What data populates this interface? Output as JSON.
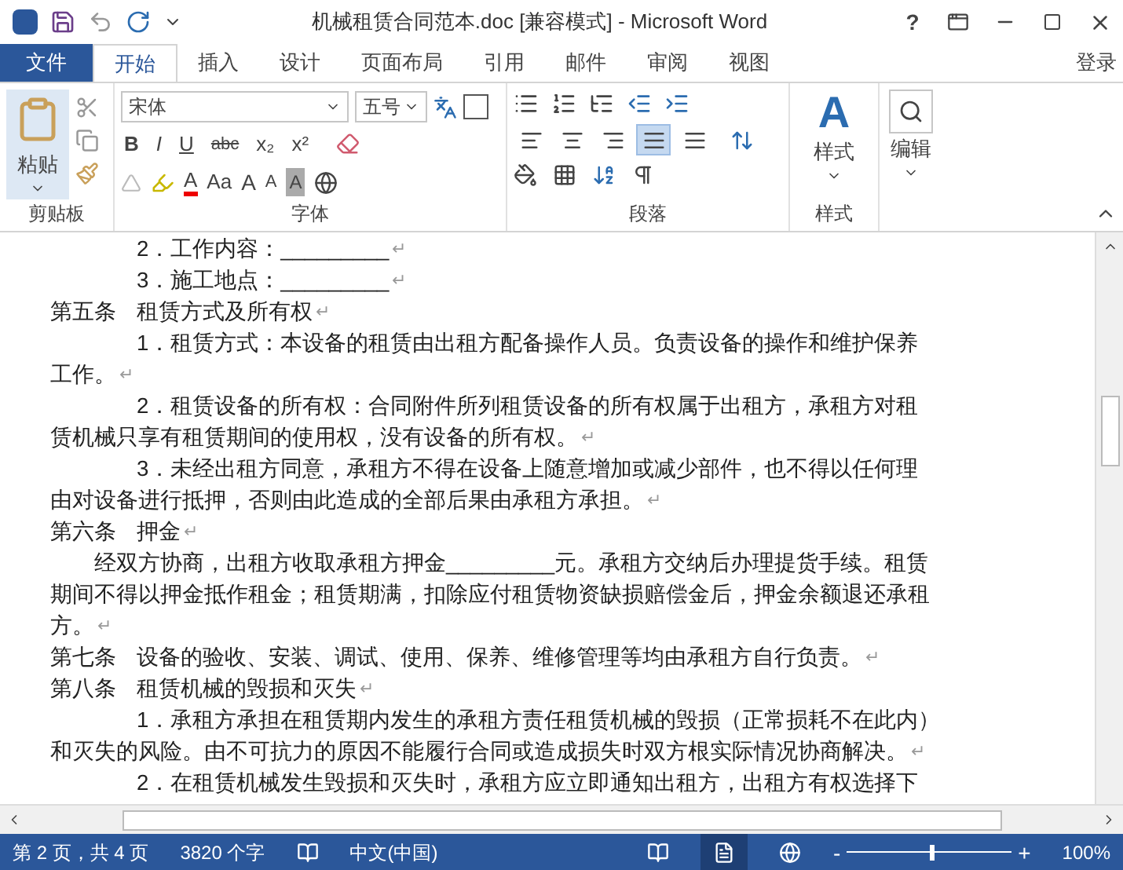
{
  "window": {
    "title": "机械租赁合同范本.doc [兼容模式] - Microsoft Word",
    "help": "?"
  },
  "tabs": [
    {
      "label": "文件",
      "kind": "file",
      "selected": false
    },
    {
      "label": "开始",
      "kind": "tab",
      "selected": true
    },
    {
      "label": "插入",
      "kind": "tab",
      "selected": false
    },
    {
      "label": "设计",
      "kind": "tab",
      "selected": false
    },
    {
      "label": "页面布局",
      "kind": "tab",
      "selected": false
    },
    {
      "label": "引用",
      "kind": "tab",
      "selected": false
    },
    {
      "label": "邮件",
      "kind": "tab",
      "selected": false
    },
    {
      "label": "审阅",
      "kind": "tab",
      "selected": false
    },
    {
      "label": "视图",
      "kind": "tab",
      "selected": false
    }
  ],
  "sign_in": "登录",
  "ribbon": {
    "clipboard": {
      "paste": "粘贴",
      "label": "剪贴板"
    },
    "font": {
      "name": "宋体",
      "size": "五号",
      "format": [
        "B",
        "I",
        "U",
        "abc",
        "x₂",
        "x²"
      ],
      "case": "Aa",
      "grow": "A",
      "shrink": "A",
      "font_color_glyph": "A",
      "shade": "A",
      "label": "字体"
    },
    "paragraph": {
      "align": [
        {
          "kind": "left",
          "selected": false
        },
        {
          "kind": "center",
          "selected": false
        },
        {
          "kind": "right",
          "selected": false
        },
        {
          "kind": "justify",
          "selected": true
        },
        {
          "kind": "distributed",
          "selected": false
        }
      ],
      "label": "段落"
    },
    "styles": {
      "glyph": "A",
      "button": "样式",
      "label": "样式"
    },
    "editing": {
      "button": "编辑"
    }
  },
  "document": [
    {
      "kind": "item",
      "lines": [
        "2．工作内容：_________"
      ],
      "end_mark": "↵"
    },
    {
      "kind": "item",
      "lines": [
        "3．施工地点：_________"
      ],
      "end_mark": "↵"
    },
    {
      "kind": "article",
      "number": "第五条",
      "title": "租赁方式及所有权",
      "end_mark": "↵"
    },
    {
      "kind": "item",
      "lines": [
        "1．租赁方式：本设备的租赁由出租方配备操作人员。负责设备的操作和维护保养",
        "工作。"
      ],
      "end_mark": "↵"
    },
    {
      "kind": "item",
      "lines": [
        "2．租赁设备的所有权：合同附件所列租赁设备的所有权属于出租方，承租方对租",
        "赁机械只享有租赁期间的使用权，没有设备的所有权。"
      ],
      "end_mark": "↵"
    },
    {
      "kind": "item",
      "lines": [
        "3．未经出租方同意，承租方不得在设备上随意增加或减少部件，也不得以任何理",
        "由对设备进行抵押，否则由此造成的全部后果由承租方承担。"
      ],
      "end_mark": "↵"
    },
    {
      "kind": "article",
      "number": "第六条",
      "title": "押金",
      "end_mark": "↵"
    },
    {
      "kind": "body",
      "lines": [
        "经双方协商，出租方收取承租方押金_________元。承租方交纳后办理提货手续。租赁",
        "期间不得以押金抵作租金；租赁期满，扣除应付租赁物资缺损赔偿金后，押金余额退还承租",
        "方。"
      ],
      "end_mark": "↵"
    },
    {
      "kind": "article",
      "number": "第七条",
      "title": "设备的验收、安装、调试、使用、保养、维修管理等均由承租方自行负责。",
      "end_mark": "↵"
    },
    {
      "kind": "article",
      "number": "第八条",
      "title": "租赁机械的毁损和灭失",
      "end_mark": "↵"
    },
    {
      "kind": "item",
      "lines": [
        "1．承租方承担在租赁期内发生的承租方责任租赁机械的毁损（正常损耗不在此内）",
        "和灭失的风险。由不可抗力的原因不能履行合同或造成损失时双方根实际情况协商解决。"
      ],
      "end_mark": "↵"
    },
    {
      "kind": "item",
      "lines": [
        "2．在租赁机械发生毁损和灭失时，承租方应立即通知出租方，出租方有权选择下"
      ]
    }
  ],
  "status_bar": {
    "page": "第 2 页，共 4 页",
    "words": "3820 个字",
    "language": "中文(中国)",
    "zoom_out": "-",
    "zoom_in": "+",
    "zoom": "100%",
    "zoom_slider": {
      "level": 0.5
    }
  }
}
